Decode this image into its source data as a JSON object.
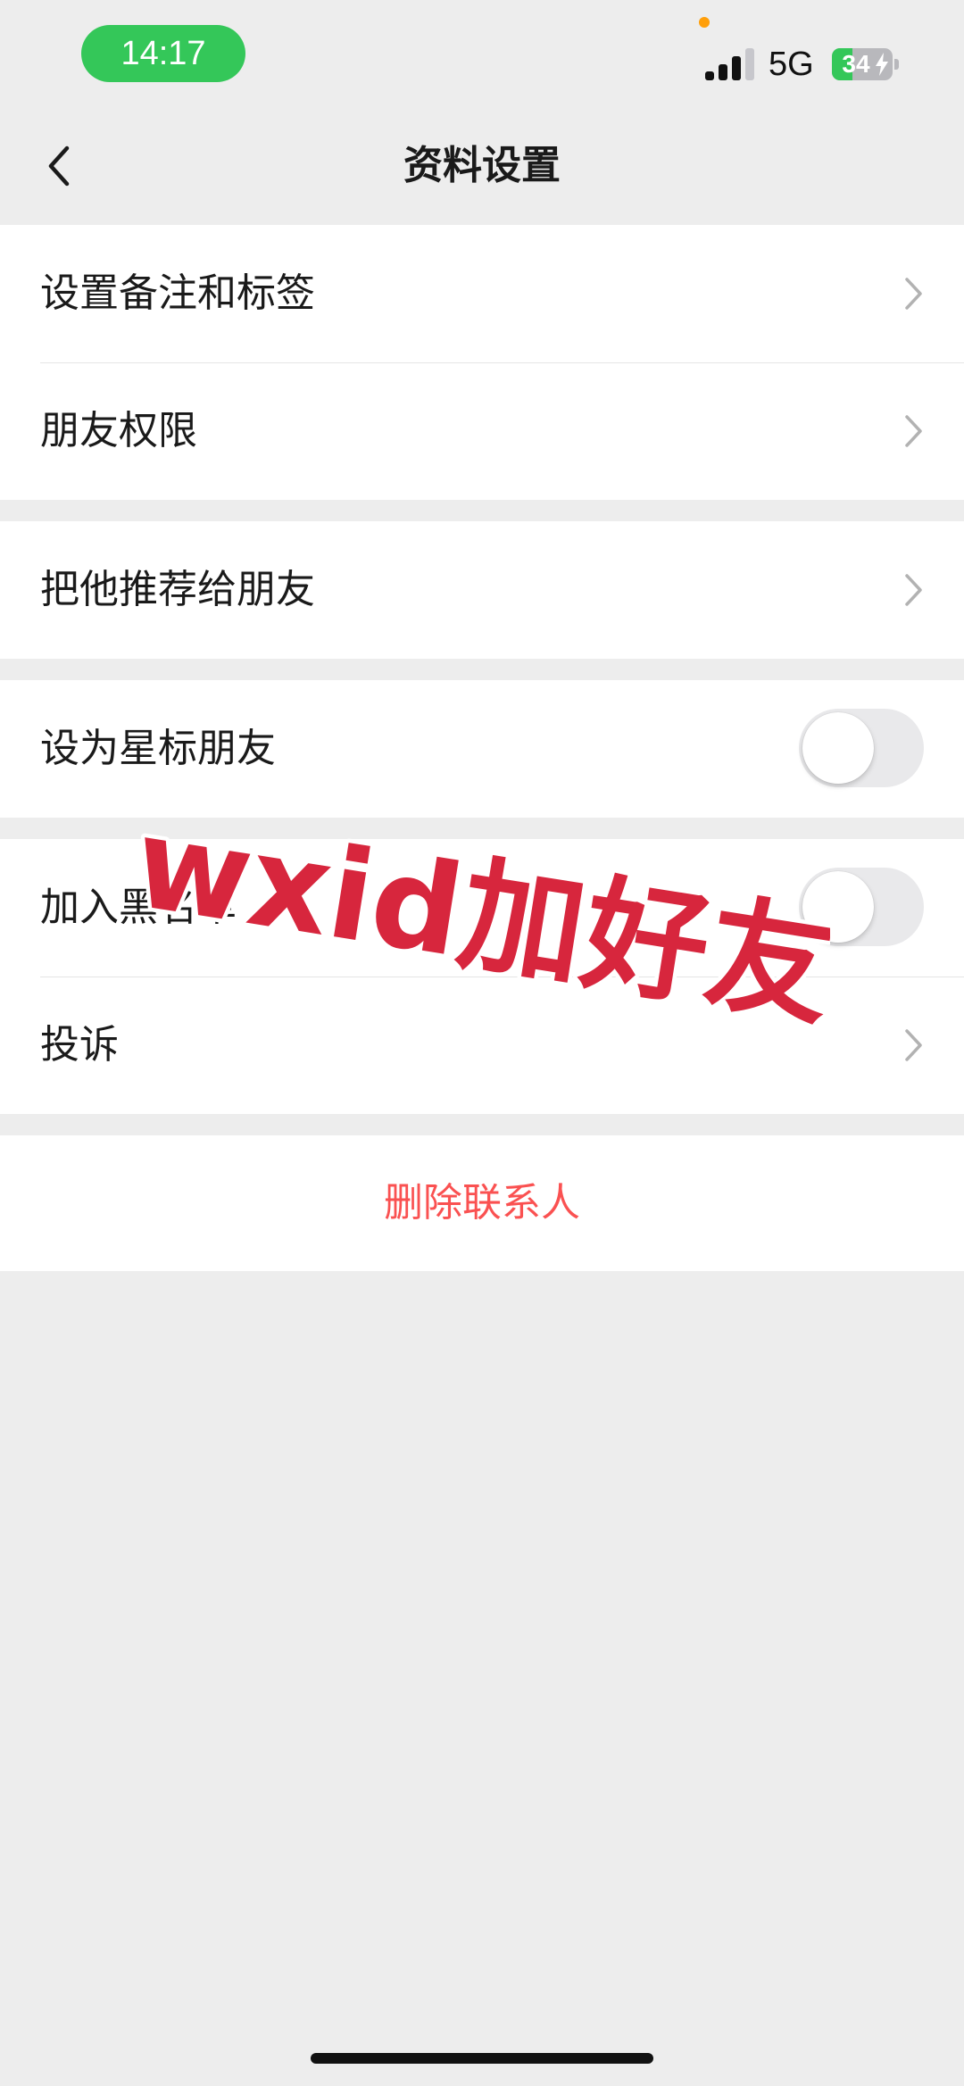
{
  "status_bar": {
    "time": "14:17",
    "network": "5G",
    "battery_percent": "34",
    "battery_level": 0.34,
    "colors": {
      "time_pill": "#34c759",
      "privacy_dot": "#ff9f0a",
      "battery_fill": "#34c759"
    }
  },
  "nav": {
    "title": "资料设置",
    "back_icon": "chevron-left-icon"
  },
  "groups": [
    {
      "rows": [
        {
          "label": "设置备注和标签",
          "control": "chevron"
        },
        {
          "label": "朋友权限",
          "control": "chevron"
        }
      ]
    },
    {
      "rows": [
        {
          "label": "把他推荐给朋友",
          "control": "chevron"
        }
      ]
    },
    {
      "rows": [
        {
          "label": "设为星标朋友",
          "control": "toggle",
          "on": false
        }
      ]
    },
    {
      "rows": [
        {
          "label": "加入黑名单",
          "control": "toggle",
          "on": false
        },
        {
          "label": "投诉",
          "control": "chevron"
        }
      ]
    }
  ],
  "delete_button": {
    "label": "删除联系人",
    "color": "#fa5151"
  },
  "watermark": {
    "text": "wxid加好友",
    "color": "#d7263d"
  }
}
